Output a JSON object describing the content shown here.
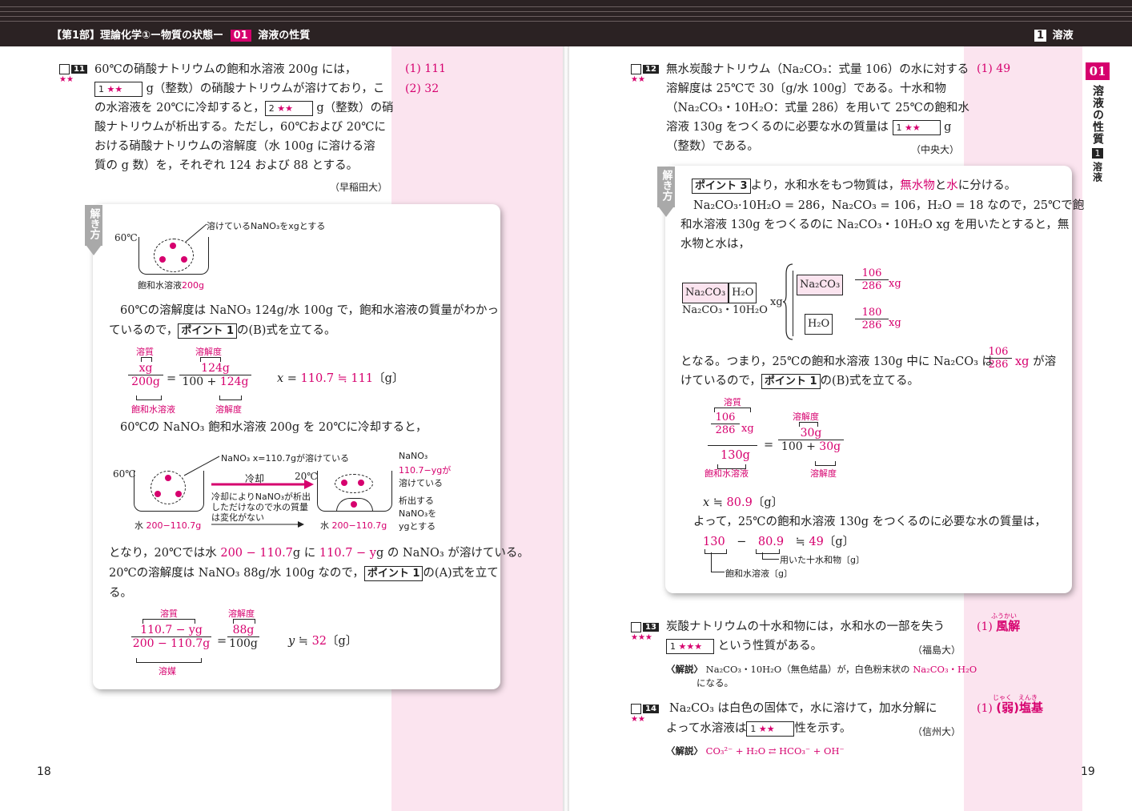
{
  "header": {
    "left_title": "【第1部】理論化学①ー物質の状態ー",
    "left_chapter_num": "01",
    "left_chapter": "溶液の性質",
    "right_num": "1",
    "right_title": "溶液"
  },
  "sidebar": {
    "num": "01",
    "chapter": "溶液の性質",
    "sec_num": "1",
    "sec": "溶液"
  },
  "page_left": "18",
  "page_right": "19",
  "q11": {
    "num": "11",
    "stars": "★★",
    "l1": "60℃の硝酸ナトリウムの飽和水溶液 200g には，",
    "blank1": "1",
    "blank1_stars": "★★",
    "l2": "g（整数）の硝酸ナトリウムが溶けており，こ",
    "l3a": "の水溶液を 20℃に冷却すると，",
    "blank2": "2",
    "blank2_stars": "★★",
    "l3b": "g（整数）の硝",
    "l4": "酸ナトリウムが析出する。ただし，60℃および 20℃に",
    "l5": "おける硝酸ナトリウムの溶解度（水 100g に溶ける溶",
    "l6": "質の g 数）を，それぞれ 124 および 88 とする。",
    "source": "（早稲田大）",
    "ans1": "(1) 111",
    "ans2": "(2) 32"
  },
  "sol11": {
    "tab": "解き方",
    "d1_temp": "60℃",
    "d1_label": "溶けているNaNO₃をxgとする",
    "d1_bottom_a": "飽和水溶液",
    "d1_bottom_b": "200g",
    "p1": "60℃の溶解度は NaNO₃ 124g/水 100g で，飽和水溶液の質量がわかっ",
    "p2a": "ているので，",
    "point": "ポイント 1",
    "p2b": "の(B)式を立てる。",
    "f1_top_lbl": "溶質",
    "f1_num": "xg",
    "f1_den": "200g",
    "f1_bot_lbl": "飽和水溶液",
    "f1_eq": "=",
    "f1_r_top_lbl": "溶解度",
    "f1_r_num": "124g",
    "f1_r_den_a": "100 + ",
    "f1_r_den_b": "124g",
    "f1_r_bot_lbl": "溶解度",
    "f1_res_a": "x = ",
    "f1_res_b": "110.7 ≒ 111",
    "f1_res_c": "〔g〕",
    "p3": "60℃の NaNO₃ 飽和水溶液 200g を 20℃に冷却すると，",
    "d2_temp1": "60℃",
    "d2_label1": "NaNO₃ x=110.7gが溶けている",
    "d2_arrow": "冷却",
    "d2_temp2": "20℃",
    "d2_note": "冷却によりNaNO₃が析出しただけなので水の質量は変化がない",
    "d2_water1_a": "水 ",
    "d2_water1_b": "200−110.7g",
    "d2_water2_a": "水 ",
    "d2_water2_b": "200−110.7g",
    "d2_r1": "NaNO₃",
    "d2_r2": "110.7−ygが",
    "d2_r3": "溶けている",
    "d2_r4": "析出する",
    "d2_r5": "NaNO₃を",
    "d2_r6": "ygとする",
    "p4a": "となり，20℃では水 ",
    "p4b": "200 − 110.7",
    "p4c": "g に ",
    "p4d": "110.7 − y",
    "p4e": "g の NaNO₃ が溶けている。",
    "p5a": "20℃の溶解度は NaNO₃ 88g/水 100g なので，",
    "p5b": "の(A)式を立て",
    "p6": "る。",
    "f2_top_lbl": "溶質",
    "f2_num": "110.7 − yg",
    "f2_den": "200 − 110.7g",
    "f2_bot_lbl": "溶媒",
    "f2_r_top_lbl": "溶解度",
    "f2_r_num": "88g",
    "f2_r_den": "100g",
    "f2_res_a": "y ≒ ",
    "f2_res_b": "32",
    "f2_res_c": "〔g〕"
  },
  "q12": {
    "num": "12",
    "stars": "★★",
    "l1": "無水炭酸ナトリウム（Na₂CO₃：式量 106）の水に対する",
    "l2": "溶解度は 25℃で 30〔g/水 100g〕である。十水和物",
    "l3": "（Na₂CO₃・10H₂O：式量 286）を用いて 25℃の飽和水",
    "l4a": "溶液 130g をつくるのに必要な水の質量は",
    "blank1": "1",
    "blank1_stars": "★★",
    "l4b": "g",
    "l5": "（整数）である。",
    "source": "（中央大）",
    "ans1": "(1) 49"
  },
  "sol12": {
    "tab": "解き方",
    "point3": "ポイント 3",
    "p1a": "より，水和水をもつ物質は，",
    "p1b": "無水物",
    "p1c": "と",
    "p1d": "水",
    "p1e": "に分ける。",
    "p2": "Na₂CO₃·10H₂O = 286，Na₂CO₃ = 106，H₂O = 18 なので，25℃で飽",
    "p3": "和水溶液 130g をつくるのに Na₂CO₃・10H₂O xg を用いたとすると，無",
    "p4": "水物と水は，",
    "d_na": "Na₂CO₃",
    "d_h2o": "H₂O",
    "d_full": "Na₂CO₃・10H₂O",
    "d_xg": "xg",
    "d_na2": "Na₂CO₃",
    "d_f1n": "106",
    "d_f1d": "286",
    "d_f1x": "xg",
    "d_h2o2": "H₂O",
    "d_f2n": "180",
    "d_f2d": "286",
    "d_f2x": "xg",
    "p5a": "となる。つまり，25℃の飽和水溶液 130g 中に Na₂CO₃ は",
    "p5_fn": "106",
    "p5_fd": "286",
    "p5b": "xg",
    "p5c": "が溶",
    "p6a": "けているので，",
    "point1": "ポイント 1",
    "p6b": "の(B)式を立てる。",
    "f_top_lbl": "溶質",
    "f_in_n": "106",
    "f_in_d": "286",
    "f_in_x": "xg",
    "f_den": "130g",
    "f_bot_lbl": "飽和水溶液",
    "f_eq": "=",
    "f_r_top_lbl": "溶解度",
    "f_r_num": "30g",
    "f_r_den_a": "100 + ",
    "f_r_den_b": "30g",
    "f_r_bot_lbl": "溶解度",
    "res1a": "x ≒ ",
    "res1b": "80.9",
    "res1c": "〔g〕",
    "p7": "よって，25℃の飽和水溶液 130g をつくるのに必要な水の質量は，",
    "calc_a": "130",
    "calc_b": "−",
    "calc_c": "80.9",
    "calc_d": "≒ ",
    "calc_e": "49",
    "calc_f": "〔g〕",
    "lbl_used": "用いた十水和物〔g〕",
    "lbl_sol": "飽和水溶液〔g〕"
  },
  "q13": {
    "num": "13",
    "stars": "★★★",
    "l1": "炭酸ナトリウムの十水和物には，水和水の一部を失う",
    "blank1": "1",
    "blank1_stars": "★★★",
    "l2": "という性質がある。",
    "source": "（福島大）",
    "exp_a": "〈解説〉",
    "exp_b": "Na₂CO₃・10H₂O（無色結晶）が，白色粉末状の ",
    "exp_c": "Na₂CO₃・H₂O",
    "exp_d": "になる。",
    "ans_a": "(1) ",
    "ans_ruby": "ふうかい",
    "ans_b": "風解"
  },
  "q14": {
    "num": "14",
    "stars": "★★",
    "l1": "Na₂CO₃ は白色の固体で，水に溶けて，加水分解に",
    "l2a": "よって水溶液は",
    "blank1": "1",
    "blank1_stars": "★★",
    "l2b": "性を示す。",
    "source": "（信州大）",
    "exp_a": "〈解説〉",
    "exp_b": "CO₃²⁻ + H₂O ⇄ HCO₃⁻ + OH⁻",
    "ans_a": "(1) ",
    "ans_ruby": "じゃく　えんき",
    "ans_b": "(弱)塩基"
  }
}
